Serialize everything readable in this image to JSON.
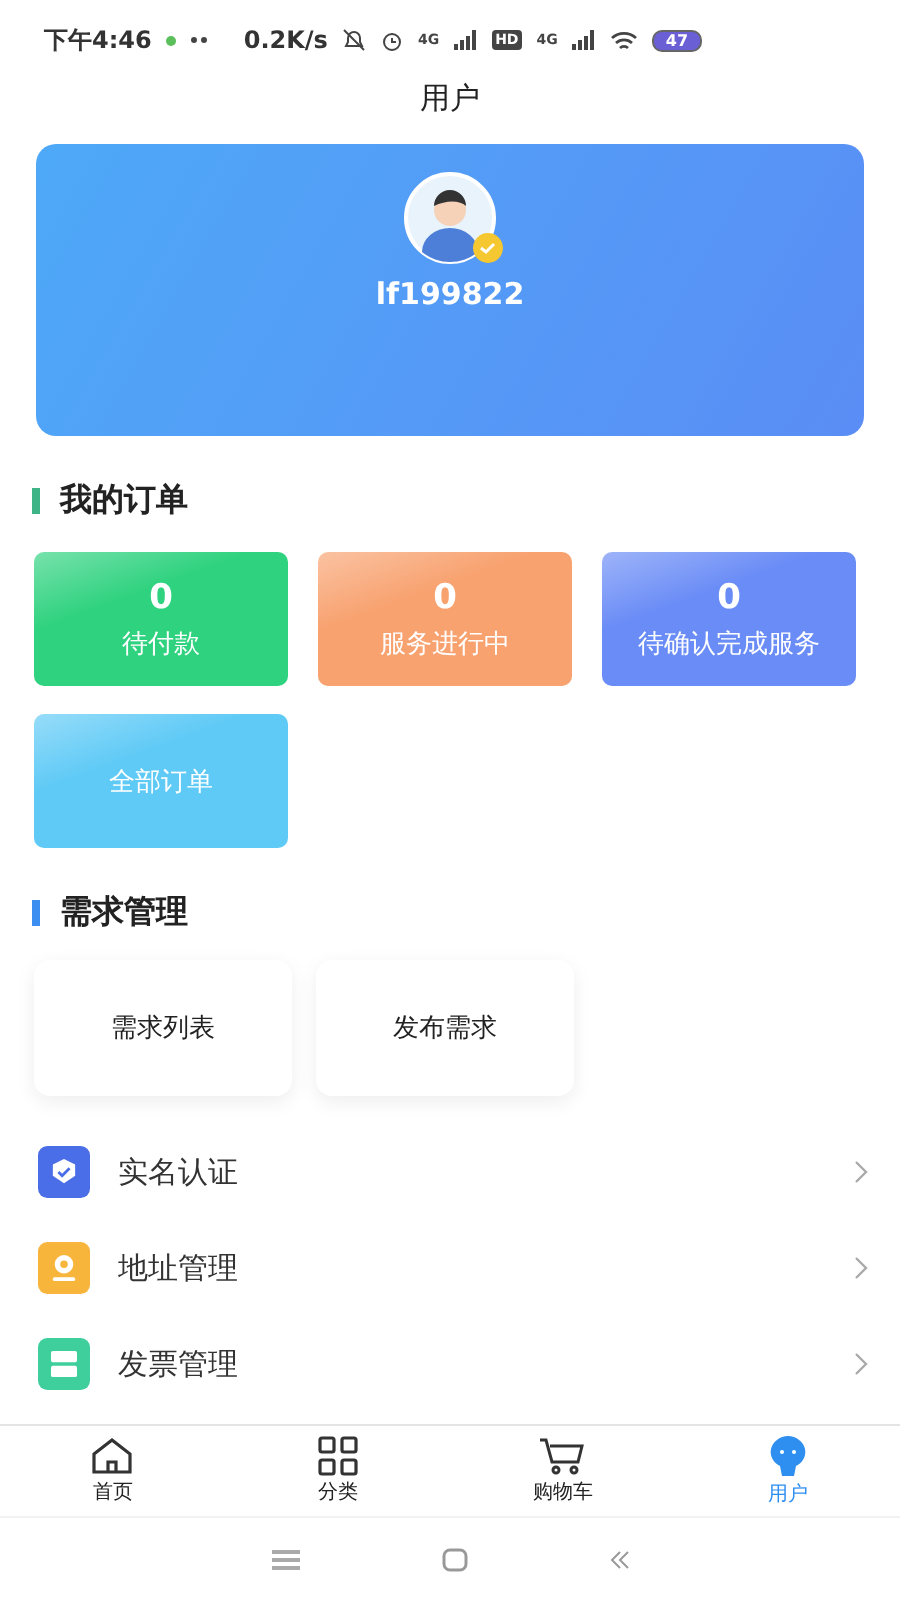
{
  "status_bar": {
    "time": "下午4:46",
    "net_speed": "0.2K/s",
    "hd": "HD",
    "sim_1": "4G",
    "sim_2": "4G",
    "battery": "47"
  },
  "title": "用户",
  "profile": {
    "username": "lf199822",
    "verified": true
  },
  "orders": {
    "heading": "我的订单",
    "cards": [
      {
        "count": "0",
        "label": "待付款",
        "color": "#2fd27f"
      },
      {
        "count": "0",
        "label": "服务进行中",
        "color": "#f8a270"
      },
      {
        "count": "0",
        "label": "待确认完成服务",
        "color": "#6a8cf6"
      },
      {
        "label": "全部订单",
        "color": "#5fcaf6"
      }
    ]
  },
  "demand": {
    "heading": "需求管理",
    "cards": [
      "需求列表",
      "发布需求"
    ]
  },
  "menu": [
    {
      "label": "实名认证",
      "kind": "verify",
      "color": "#4a6ee8"
    },
    {
      "label": "地址管理",
      "kind": "address",
      "color": "#f7b53c"
    },
    {
      "label": "发票管理",
      "kind": "invoice",
      "color": "#3fcf9c"
    }
  ],
  "tabs": [
    {
      "label": "首页",
      "kind": "home",
      "selected": false
    },
    {
      "label": "分类",
      "kind": "grid",
      "selected": false
    },
    {
      "label": "购物车",
      "kind": "cart",
      "selected": false
    },
    {
      "label": "用户",
      "kind": "user",
      "selected": true
    }
  ]
}
